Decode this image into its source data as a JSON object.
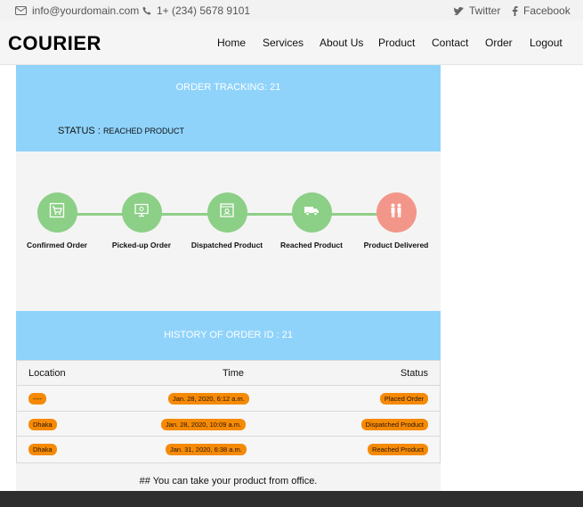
{
  "topbar": {
    "email": "info@yourdomain.com",
    "phone": "1+ (234) 5678 9101",
    "twitter": "Twitter",
    "facebook": "Facebook"
  },
  "brand": "COURIER",
  "nav": [
    "Home",
    "Services",
    "About Us",
    "Product",
    "Contact",
    "Order",
    "Logout"
  ],
  "tracking": {
    "title": "ORDER TRACKING: 21",
    "status_label": "STATUS : ",
    "status_value": "REACHED PRODUCT"
  },
  "steps": [
    {
      "label": "Confirmed Order",
      "state": "done",
      "icon": "cart-icon"
    },
    {
      "label": "Picked-up Order",
      "state": "done",
      "icon": "monitor-icon"
    },
    {
      "label": "Dispatched Product",
      "state": "done",
      "icon": "box-icon"
    },
    {
      "label": "Reached Product",
      "state": "done",
      "icon": "truck-icon"
    },
    {
      "label": "Product Delivered",
      "state": "pending",
      "icon": "people-icon"
    }
  ],
  "history": {
    "title": "HISTORY OF ORDER ID : 21",
    "columns": [
      "Location",
      "Time",
      "Status"
    ],
    "rows": [
      {
        "location": "----",
        "time": "Jan. 28, 2020, 6:12 a.m.",
        "status": "Placed Order"
      },
      {
        "location": "Dhaka",
        "time": "Jan. 28, 2020, 10:09 a.m.",
        "status": "Dispatched Product"
      },
      {
        "location": "Dhaka",
        "time": "Jan. 31, 2020, 6:38 a.m.",
        "status": "Reached Product"
      }
    ]
  },
  "note": "## You can take your product from office.",
  "colors": {
    "header_blue": "#8fd3fb",
    "step_done": "#8ccf86",
    "step_pending": "#f3968a",
    "badge": "#f58a07"
  }
}
